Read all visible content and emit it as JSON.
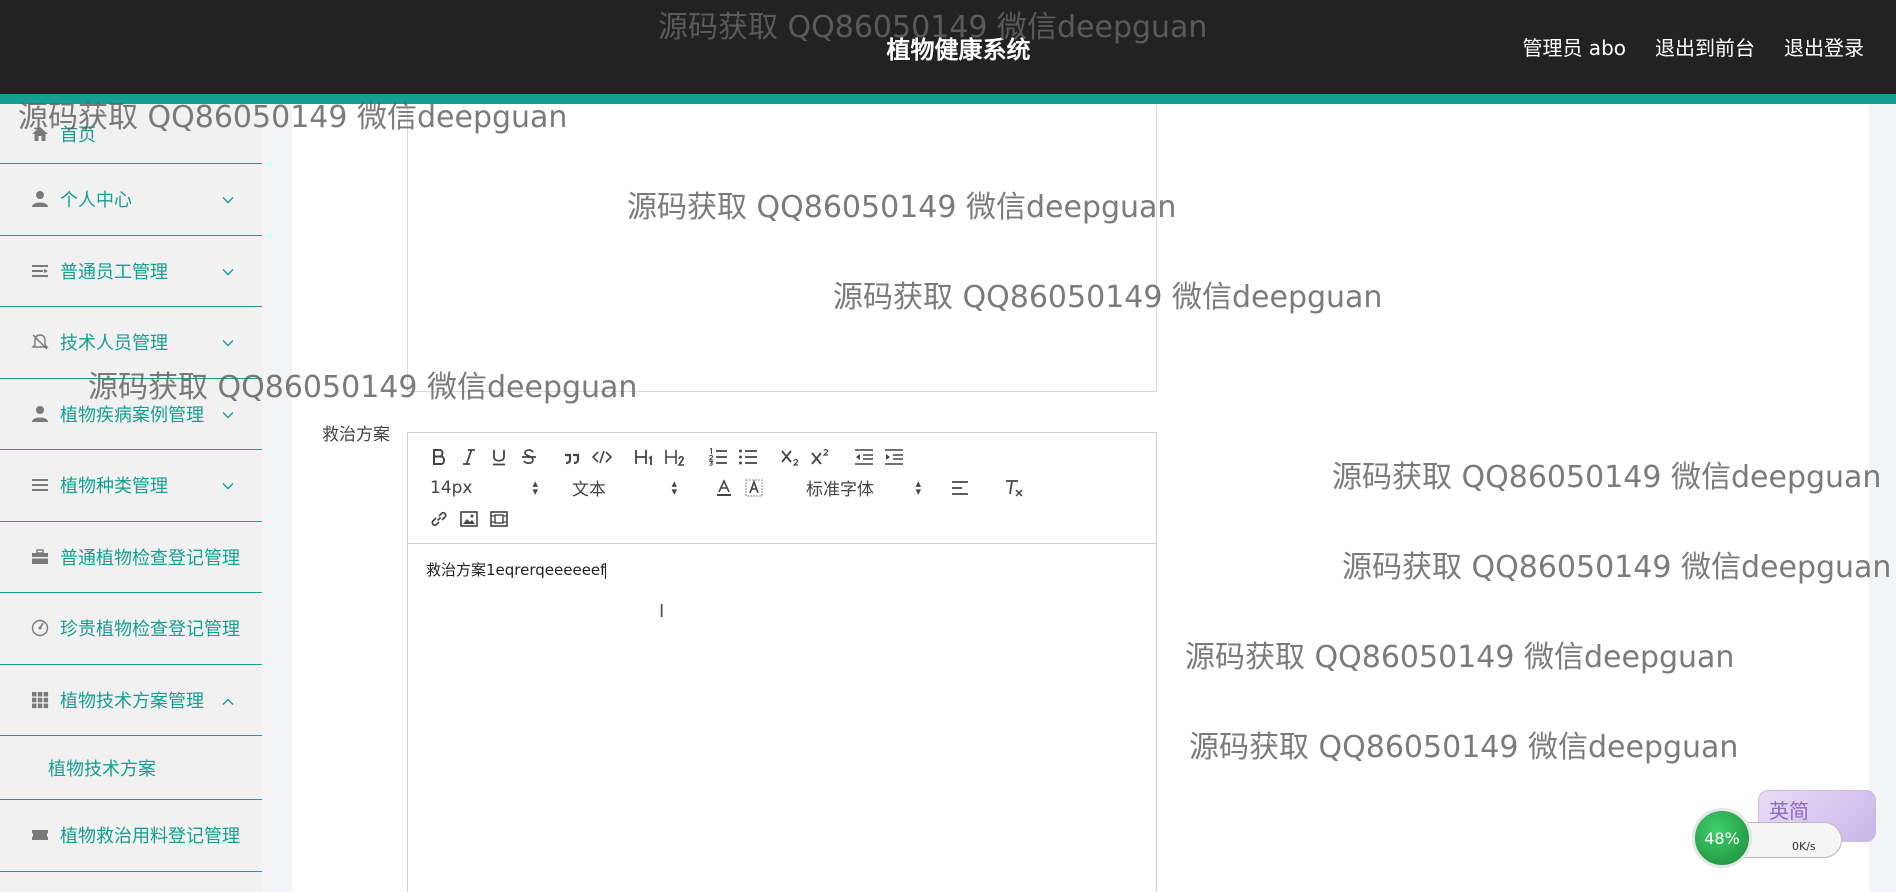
{
  "header": {
    "title": "植物健康系统",
    "user_label": "管理员 abo",
    "front_link": "退出到前台",
    "logout_link": "退出登录"
  },
  "sidebar": {
    "items": [
      {
        "label": "首页"
      },
      {
        "label": "个人中心"
      },
      {
        "label": "普通员工管理"
      },
      {
        "label": "技术人员管理"
      },
      {
        "label": "植物疾病案例管理"
      },
      {
        "label": "植物种类管理"
      },
      {
        "label": "普通植物检查登记管理"
      },
      {
        "label": "珍贵植物检查登记管理"
      },
      {
        "label": "植物技术方案管理"
      },
      {
        "label": "植物救治用料登记管理"
      }
    ],
    "submenu": {
      "label": "植物技术方案"
    }
  },
  "form": {
    "field_label": "救治方案",
    "editor": {
      "font_size": "14px",
      "paragraph": "文本",
      "font_family": "标准字体",
      "content": "救治方案1eqrerqeeeeeef"
    }
  },
  "widgets": {
    "net_percent": "48%",
    "net_speed": "0K/s",
    "ime_label": "英简"
  },
  "watermarks": [
    "源码获取 QQ86050149 微信deepguan",
    "源码获取 QQ86050149 微信deepguan",
    "源码获取 QQ86050149 微信deepguan",
    "源码获取 QQ86050149 微信deepguan",
    "源码获取 QQ86050149 微信deepguan",
    "源码获取 QQ86050149 微信deepguan",
    "源码获取 QQ86050149 微信deepguan",
    "源码获取 QQ86050149 微信deepguan",
    "源码获取 QQ86050149 微信deepguan"
  ],
  "colors": {
    "accent": "#159f90",
    "header_bg": "#222222"
  }
}
